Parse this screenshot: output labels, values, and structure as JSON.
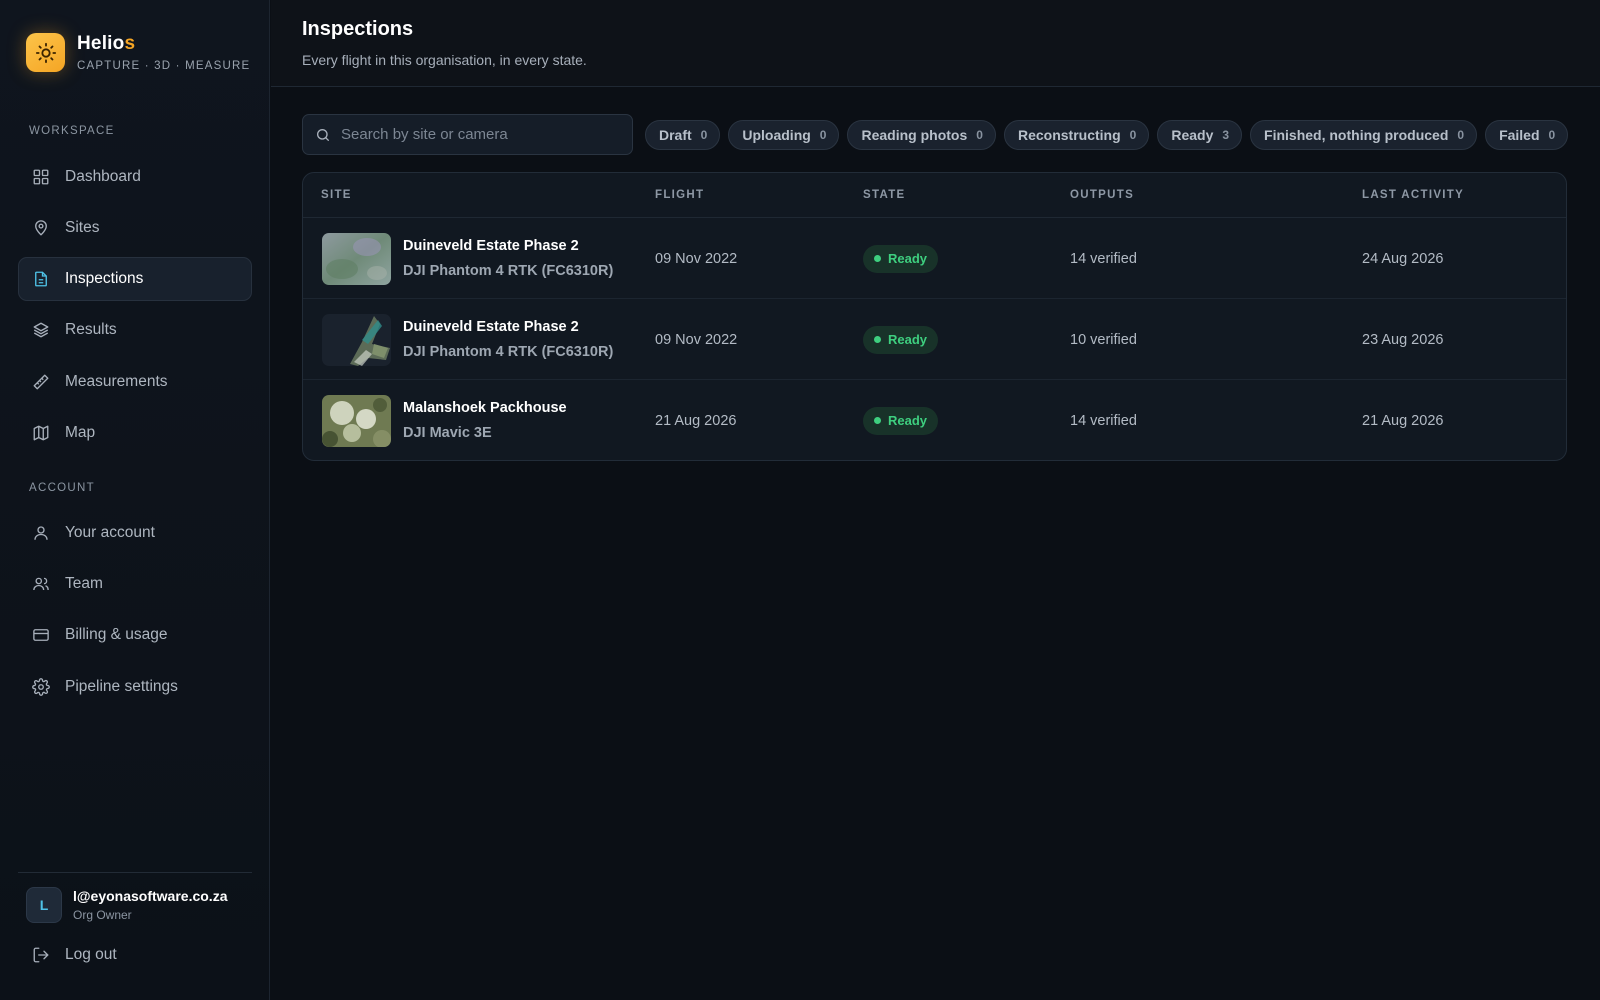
{
  "brand": {
    "name_main": "Helio",
    "name_accent": "s",
    "tagline": "CAPTURE · 3D · MEASURE",
    "logo_icon": "sun-icon"
  },
  "sidebar": {
    "workspace_label": "WORKSPACE",
    "workspace_items": [
      {
        "label": "Dashboard",
        "icon": "grid-icon"
      },
      {
        "label": "Sites",
        "icon": "pin-icon"
      },
      {
        "label": "Inspections",
        "icon": "document-icon",
        "active": true
      },
      {
        "label": "Results",
        "icon": "layers-icon"
      },
      {
        "label": "Measurements",
        "icon": "ruler-icon"
      },
      {
        "label": "Map",
        "icon": "map-icon"
      }
    ],
    "account_label": "ACCOUNT",
    "account_items": [
      {
        "label": "Your account",
        "icon": "user-icon"
      },
      {
        "label": "Team",
        "icon": "users-icon"
      },
      {
        "label": "Billing & usage",
        "icon": "card-icon"
      },
      {
        "label": "Pipeline settings",
        "icon": "gear-icon"
      }
    ],
    "user": {
      "initial": "L",
      "email": "l@eyonasoftware.co.za",
      "role": "Org Owner"
    },
    "logout_label": "Log out"
  },
  "header": {
    "title": "Inspections",
    "subtitle": "Every flight in this organisation, in every state."
  },
  "search": {
    "placeholder": "Search by site or camera",
    "value": ""
  },
  "filters": [
    {
      "label": "Draft",
      "count": "0"
    },
    {
      "label": "Uploading",
      "count": "0"
    },
    {
      "label": "Reading photos",
      "count": "0"
    },
    {
      "label": "Reconstructing",
      "count": "0"
    },
    {
      "label": "Ready",
      "count": "3"
    },
    {
      "label": "Finished, nothing produced",
      "count": "0"
    },
    {
      "label": "Failed",
      "count": "0"
    }
  ],
  "table": {
    "columns": {
      "site": "SITE",
      "flight": "FLIGHT",
      "state": "STATE",
      "outputs": "OUTPUTS",
      "last_activity": "LAST ACTIVITY"
    },
    "rows": [
      {
        "site": "Duineveld Estate Phase 2",
        "camera": "DJI Phantom 4 RTK (FC6310R)",
        "flight": "09 Nov 2022",
        "state": "Ready",
        "outputs": "14 verified",
        "last_activity": "24 Aug 2026"
      },
      {
        "site": "Duineveld Estate Phase 2",
        "camera": "DJI Phantom 4 RTK (FC6310R)",
        "flight": "09 Nov 2022",
        "state": "Ready",
        "outputs": "10 verified",
        "last_activity": "23 Aug 2026"
      },
      {
        "site": "Malanshoek Packhouse",
        "camera": "DJI Mavic 3E",
        "flight": "21 Aug 2026",
        "state": "Ready",
        "outputs": "14 verified",
        "last_activity": "21 Aug 2026"
      }
    ]
  },
  "colors": {
    "accent": "#f5a524",
    "active_icon": "#4fc3e8",
    "ready": "#3ecf7f",
    "background": "#0b0f15"
  }
}
